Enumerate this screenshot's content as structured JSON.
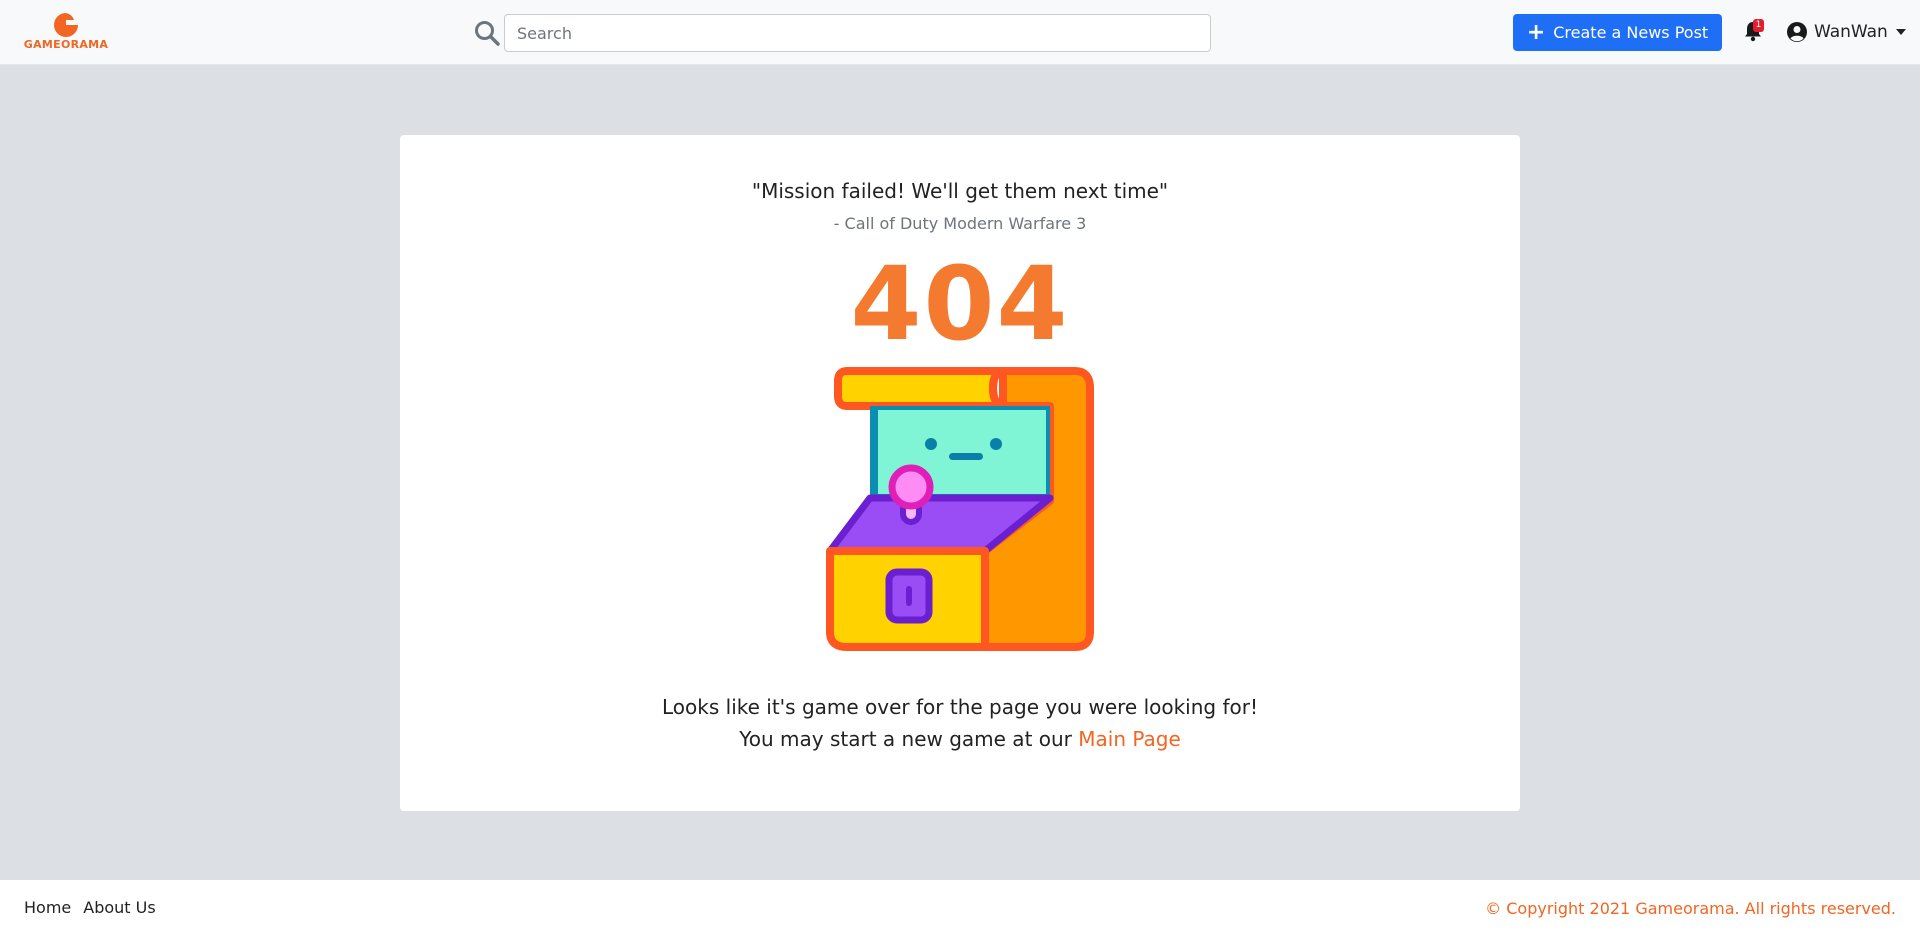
{
  "navbar": {
    "logo_text": "GAMEORAMA",
    "search_placeholder": "Search",
    "create_button_label": "Create a News Post",
    "notification_count": "1",
    "username": "WanWan"
  },
  "error_page": {
    "quote": "\"Mission failed! We'll get them next time\"",
    "quote_source": "- Call of Duty Modern Warfare 3",
    "code": "404",
    "message_line1": "Looks like it's game over for the page you were looking for!",
    "message_line2_prefix": "You may start a new game at our ",
    "main_page_link": "Main Page"
  },
  "footer": {
    "links": [
      "Home",
      "About Us"
    ],
    "copyright": "© Copyright 2021 Gameorama. All rights reserved."
  },
  "icons": {
    "search": "search-icon",
    "plus": "plus-icon",
    "bell": "bell-icon",
    "user": "user-circle-icon",
    "caret": "caret-down-icon",
    "illustration": "arcade-machine-illustration"
  },
  "colors": {
    "brand_orange": "#f26522",
    "primary_blue": "#1e6ff5",
    "page_background": "#dcdfe4",
    "badge_red": "#e11d2e"
  }
}
